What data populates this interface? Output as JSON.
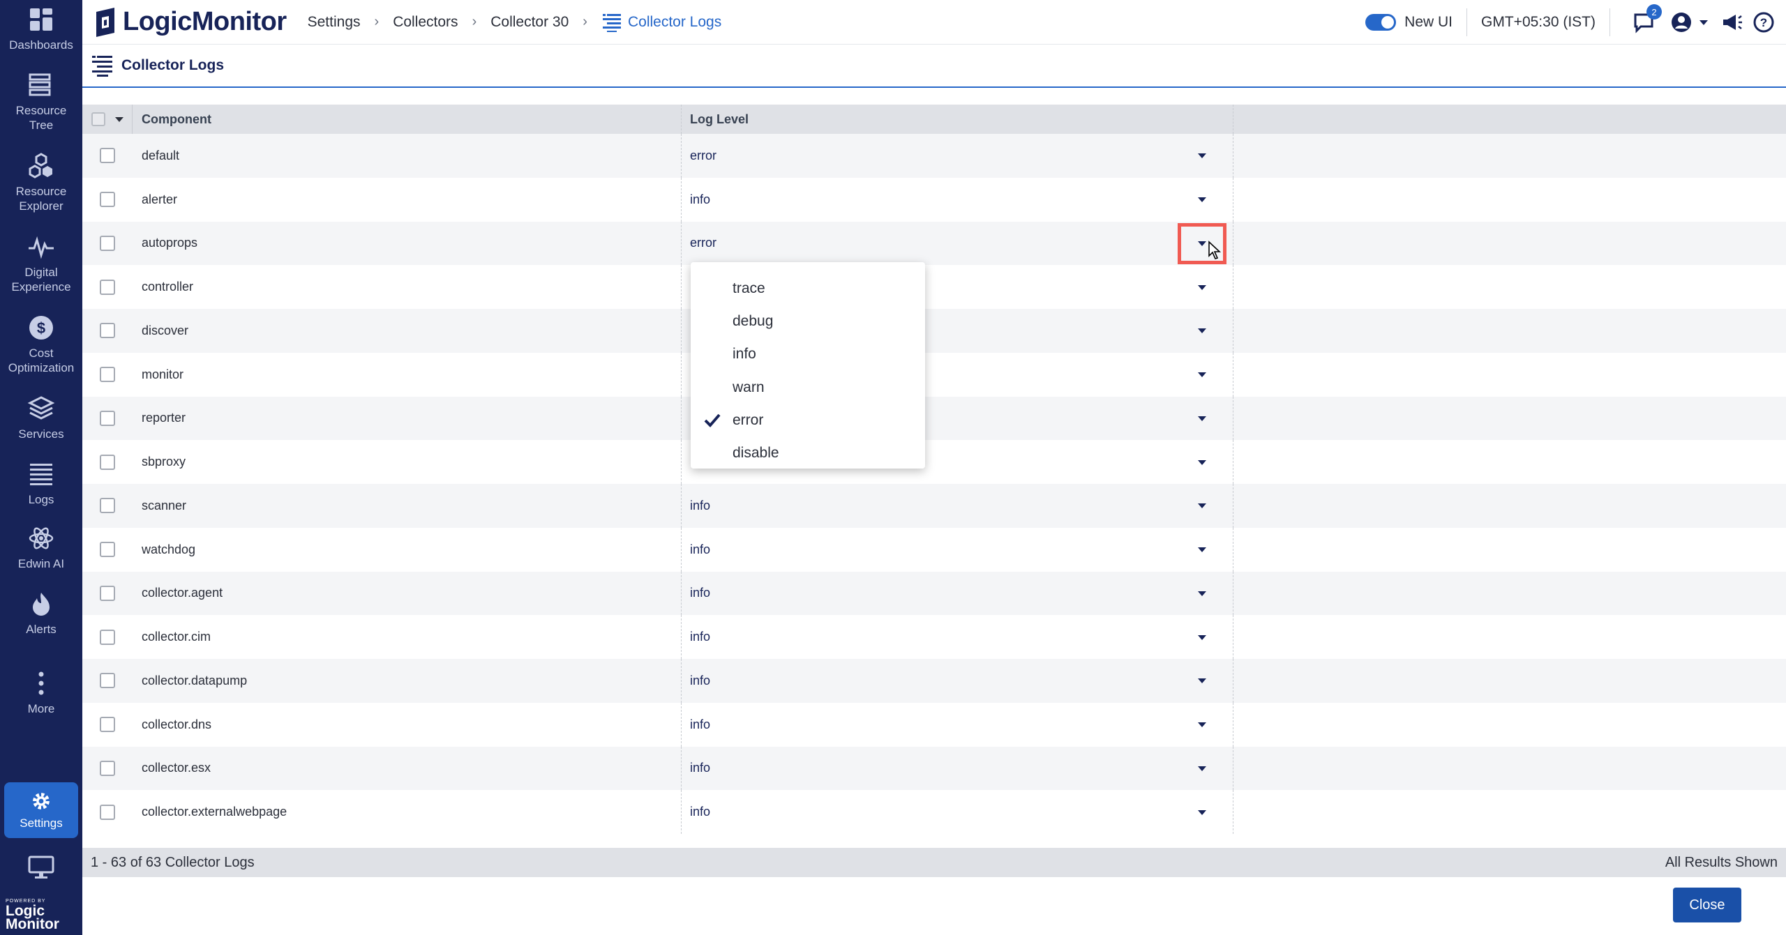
{
  "sidebar": {
    "items": [
      {
        "label": "Dashboards",
        "icon": "dashboards-icon"
      },
      {
        "label": "Resource Tree",
        "icon": "resource-tree-icon"
      },
      {
        "label": "Resource Explorer",
        "icon": "resource-explorer-icon"
      },
      {
        "label": "Digital Experience",
        "icon": "digital-experience-icon"
      },
      {
        "label": "Cost Optimization",
        "icon": "cost-optimization-icon"
      },
      {
        "label": "Services",
        "icon": "services-icon"
      },
      {
        "label": "Logs",
        "icon": "logs-icon"
      },
      {
        "label": "Edwin AI",
        "icon": "edwin-ai-icon"
      },
      {
        "label": "Alerts",
        "icon": "alerts-icon"
      },
      {
        "label": "More",
        "icon": "more-icon"
      },
      {
        "label": "Settings",
        "icon": "settings-icon"
      }
    ],
    "footer_logo_small": "POWERED BY",
    "footer_logo_line1": "Logic",
    "footer_logo_line2": "Monitor"
  },
  "topbar": {
    "brand": "LogicMonitor",
    "breadcrumbs": [
      "Settings",
      "Collectors",
      "Collector 30",
      "Collector Logs"
    ],
    "new_ui_label": "New UI",
    "timezone": "GMT+05:30 (IST)",
    "notification_count": "2"
  },
  "panel": {
    "title": "Collector Logs"
  },
  "table": {
    "headers": {
      "component": "Component",
      "log_level": "Log Level"
    },
    "rows": [
      {
        "component": "default",
        "level": "error"
      },
      {
        "component": "alerter",
        "level": "info"
      },
      {
        "component": "autoprops",
        "level": "error"
      },
      {
        "component": "controller",
        "level": ""
      },
      {
        "component": "discover",
        "level": ""
      },
      {
        "component": "monitor",
        "level": ""
      },
      {
        "component": "reporter",
        "level": ""
      },
      {
        "component": "sbproxy",
        "level": ""
      },
      {
        "component": "scanner",
        "level": "info"
      },
      {
        "component": "watchdog",
        "level": "info"
      },
      {
        "component": "collector.agent",
        "level": "info"
      },
      {
        "component": "collector.cim",
        "level": "info"
      },
      {
        "component": "collector.datapump",
        "level": "info"
      },
      {
        "component": "collector.dns",
        "level": "info"
      },
      {
        "component": "collector.esx",
        "level": "info"
      },
      {
        "component": "collector.externalwebpage",
        "level": "info"
      }
    ]
  },
  "dropdown": {
    "options": [
      "trace",
      "debug",
      "info",
      "warn",
      "error",
      "disable"
    ],
    "selected": "error"
  },
  "footer": {
    "count": "1 - 63 of 63 Collector Logs",
    "results": "All Results Shown",
    "close_label": "Close"
  },
  "colors": {
    "sidebar_bg": "#172358",
    "accent": "#2667c9",
    "highlight": "#f05a52"
  }
}
